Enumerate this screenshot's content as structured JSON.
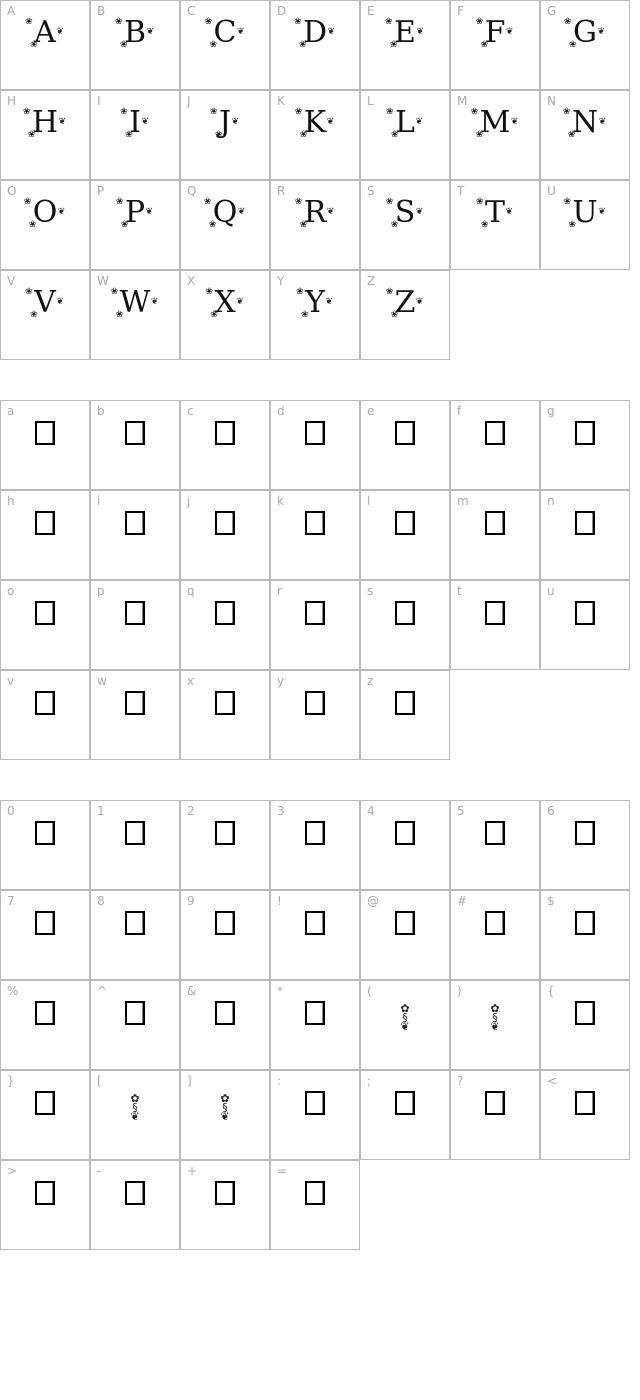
{
  "sections": [
    {
      "id": "uppercase",
      "cells": [
        {
          "label": "A",
          "glyph": "A",
          "type": "decorative"
        },
        {
          "label": "B",
          "glyph": "B",
          "type": "decorative"
        },
        {
          "label": "C",
          "glyph": "C",
          "type": "decorative"
        },
        {
          "label": "D",
          "glyph": "D",
          "type": "decorative"
        },
        {
          "label": "E",
          "glyph": "E",
          "type": "decorative"
        },
        {
          "label": "F",
          "glyph": "F",
          "type": "decorative"
        },
        {
          "label": "G",
          "glyph": "G",
          "type": "decorative"
        },
        {
          "label": "H",
          "glyph": "H",
          "type": "decorative"
        },
        {
          "label": "I",
          "glyph": "I",
          "type": "decorative"
        },
        {
          "label": "J",
          "glyph": "J",
          "type": "decorative"
        },
        {
          "label": "K",
          "glyph": "K",
          "type": "decorative"
        },
        {
          "label": "L",
          "glyph": "L",
          "type": "decorative"
        },
        {
          "label": "M",
          "glyph": "M",
          "type": "decorative"
        },
        {
          "label": "N",
          "glyph": "N",
          "type": "decorative"
        },
        {
          "label": "O",
          "glyph": "O",
          "type": "decorative"
        },
        {
          "label": "P",
          "glyph": "P",
          "type": "decorative"
        },
        {
          "label": "Q",
          "glyph": "Q",
          "type": "decorative"
        },
        {
          "label": "R",
          "glyph": "R",
          "type": "decorative"
        },
        {
          "label": "S",
          "glyph": "S",
          "type": "decorative"
        },
        {
          "label": "T",
          "glyph": "T",
          "type": "decorative"
        },
        {
          "label": "U",
          "glyph": "U",
          "type": "decorative"
        },
        {
          "label": "V",
          "glyph": "V",
          "type": "decorative"
        },
        {
          "label": "W",
          "glyph": "W",
          "type": "decorative"
        },
        {
          "label": "X",
          "glyph": "X",
          "type": "decorative"
        },
        {
          "label": "Y",
          "glyph": "Y",
          "type": "decorative"
        },
        {
          "label": "Z",
          "glyph": "Z",
          "type": "decorative"
        }
      ]
    },
    {
      "id": "lowercase",
      "cells": [
        {
          "label": "a",
          "type": "missing"
        },
        {
          "label": "b",
          "type": "missing"
        },
        {
          "label": "c",
          "type": "missing"
        },
        {
          "label": "d",
          "type": "missing"
        },
        {
          "label": "e",
          "type": "missing"
        },
        {
          "label": "f",
          "type": "missing"
        },
        {
          "label": "g",
          "type": "missing"
        },
        {
          "label": "h",
          "type": "missing"
        },
        {
          "label": "i",
          "type": "missing"
        },
        {
          "label": "j",
          "type": "missing"
        },
        {
          "label": "k",
          "type": "missing"
        },
        {
          "label": "l",
          "type": "missing"
        },
        {
          "label": "m",
          "type": "missing"
        },
        {
          "label": "n",
          "type": "missing"
        },
        {
          "label": "o",
          "type": "missing"
        },
        {
          "label": "p",
          "type": "missing"
        },
        {
          "label": "q",
          "type": "missing"
        },
        {
          "label": "r",
          "type": "missing"
        },
        {
          "label": "s",
          "type": "missing"
        },
        {
          "label": "t",
          "type": "missing"
        },
        {
          "label": "u",
          "type": "missing"
        },
        {
          "label": "v",
          "type": "missing"
        },
        {
          "label": "w",
          "type": "missing"
        },
        {
          "label": "x",
          "type": "missing"
        },
        {
          "label": "y",
          "type": "missing"
        },
        {
          "label": "z",
          "type": "missing"
        }
      ]
    },
    {
      "id": "symbols",
      "cells": [
        {
          "label": "0",
          "type": "missing"
        },
        {
          "label": "1",
          "type": "missing"
        },
        {
          "label": "2",
          "type": "missing"
        },
        {
          "label": "3",
          "type": "missing"
        },
        {
          "label": "4",
          "type": "missing"
        },
        {
          "label": "5",
          "type": "missing"
        },
        {
          "label": "6",
          "type": "missing"
        },
        {
          "label": "7",
          "type": "missing"
        },
        {
          "label": "8",
          "type": "missing"
        },
        {
          "label": "9",
          "type": "missing"
        },
        {
          "label": "!",
          "type": "missing"
        },
        {
          "label": "@",
          "type": "missing"
        },
        {
          "label": "#",
          "type": "missing"
        },
        {
          "label": "$",
          "type": "missing"
        },
        {
          "label": "%",
          "type": "missing"
        },
        {
          "label": "^",
          "type": "missing"
        },
        {
          "label": "&",
          "type": "missing"
        },
        {
          "label": "*",
          "type": "missing"
        },
        {
          "label": "(",
          "type": "ornament"
        },
        {
          "label": ")",
          "type": "ornament"
        },
        {
          "label": "{",
          "type": "missing"
        },
        {
          "label": "}",
          "type": "missing"
        },
        {
          "label": "[",
          "type": "ornament"
        },
        {
          "label": "]",
          "type": "ornament"
        },
        {
          "label": ":",
          "type": "missing"
        },
        {
          "label": ";",
          "type": "missing"
        },
        {
          "label": "?",
          "type": "missing"
        },
        {
          "label": "<",
          "type": "missing"
        },
        {
          "label": ">",
          "type": "missing"
        },
        {
          "label": "-",
          "type": "missing"
        },
        {
          "label": "+",
          "type": "missing"
        },
        {
          "label": "=",
          "type": "missing"
        }
      ]
    }
  ],
  "icons": {
    "flourish": "❀",
    "leaf": "❦",
    "ornament_stack": [
      "✿",
      "§",
      "❦"
    ]
  }
}
